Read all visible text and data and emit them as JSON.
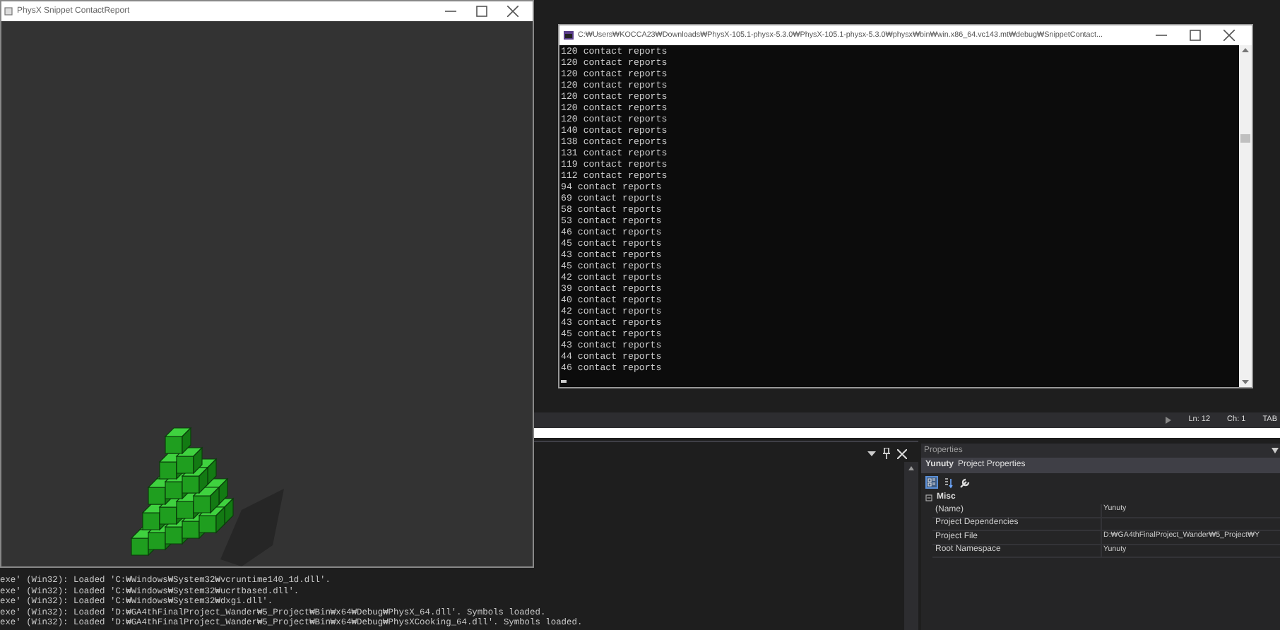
{
  "viewer_window": {
    "title": "PhysX Snippet ContactReport"
  },
  "console_window": {
    "title": "C:₩Users₩KOCCA23₩Downloads₩PhysX-105.1-physx-5.3.0₩PhysX-105.1-physx-5.3.0₩physx₩bin₩win.x86_64.vc143.mt₩debug₩SnippetContact...",
    "lines": [
      "120 contact reports",
      "120 contact reports",
      "120 contact reports",
      "120 contact reports",
      "120 contact reports",
      "120 contact reports",
      "120 contact reports",
      "140 contact reports",
      "138 contact reports",
      "131 contact reports",
      "119 contact reports",
      "112 contact reports",
      "94 contact reports",
      "69 contact reports",
      "58 contact reports",
      "53 contact reports",
      "46 contact reports",
      "45 contact reports",
      "43 contact reports",
      "45 contact reports",
      "42 contact reports",
      "39 contact reports",
      "40 contact reports",
      "42 contact reports",
      "43 contact reports",
      "45 contact reports",
      "43 contact reports",
      "44 contact reports",
      "46 contact reports"
    ]
  },
  "output_pane": {
    "lines": [
      "exe' (Win32): Loaded 'C:₩Windows₩System32₩vcruntime140_1d.dll'.",
      "exe' (Win32): Loaded 'C:₩Windows₩System32₩ucrtbased.dll'.",
      "exe' (Win32): Loaded 'C:₩Windows₩System32₩dxgi.dll'.",
      "exe' (Win32): Loaded 'D:₩GA4thFinalProject_Wander₩5_Project₩Bin₩x64₩Debug₩PhysX_64.dll'. Symbols loaded.",
      "exe' (Win32): Loaded 'D:₩GA4thFinalProject_Wander₩5_Project₩Bin₩x64₩Debug₩PhysXCooking_64.dll'. Symbols loaded."
    ]
  },
  "status_bar": {
    "line": "Ln: 12",
    "column": "Ch: 1",
    "indent": "TAB"
  },
  "properties": {
    "title": "Properties",
    "object": "Yunuty",
    "object_type": "Project Properties",
    "category": {
      "label": "Misc",
      "expanded": true
    },
    "rows": [
      {
        "name": "(Name)",
        "value": "Yunuty"
      },
      {
        "name": "Project Dependencies"
      },
      {
        "name": "Project File",
        "value": "D:₩GA4thFinalProject_Wander₩5_Project₩Y"
      },
      {
        "name": "Root Namespace",
        "value": "Yunuty"
      }
    ]
  }
}
